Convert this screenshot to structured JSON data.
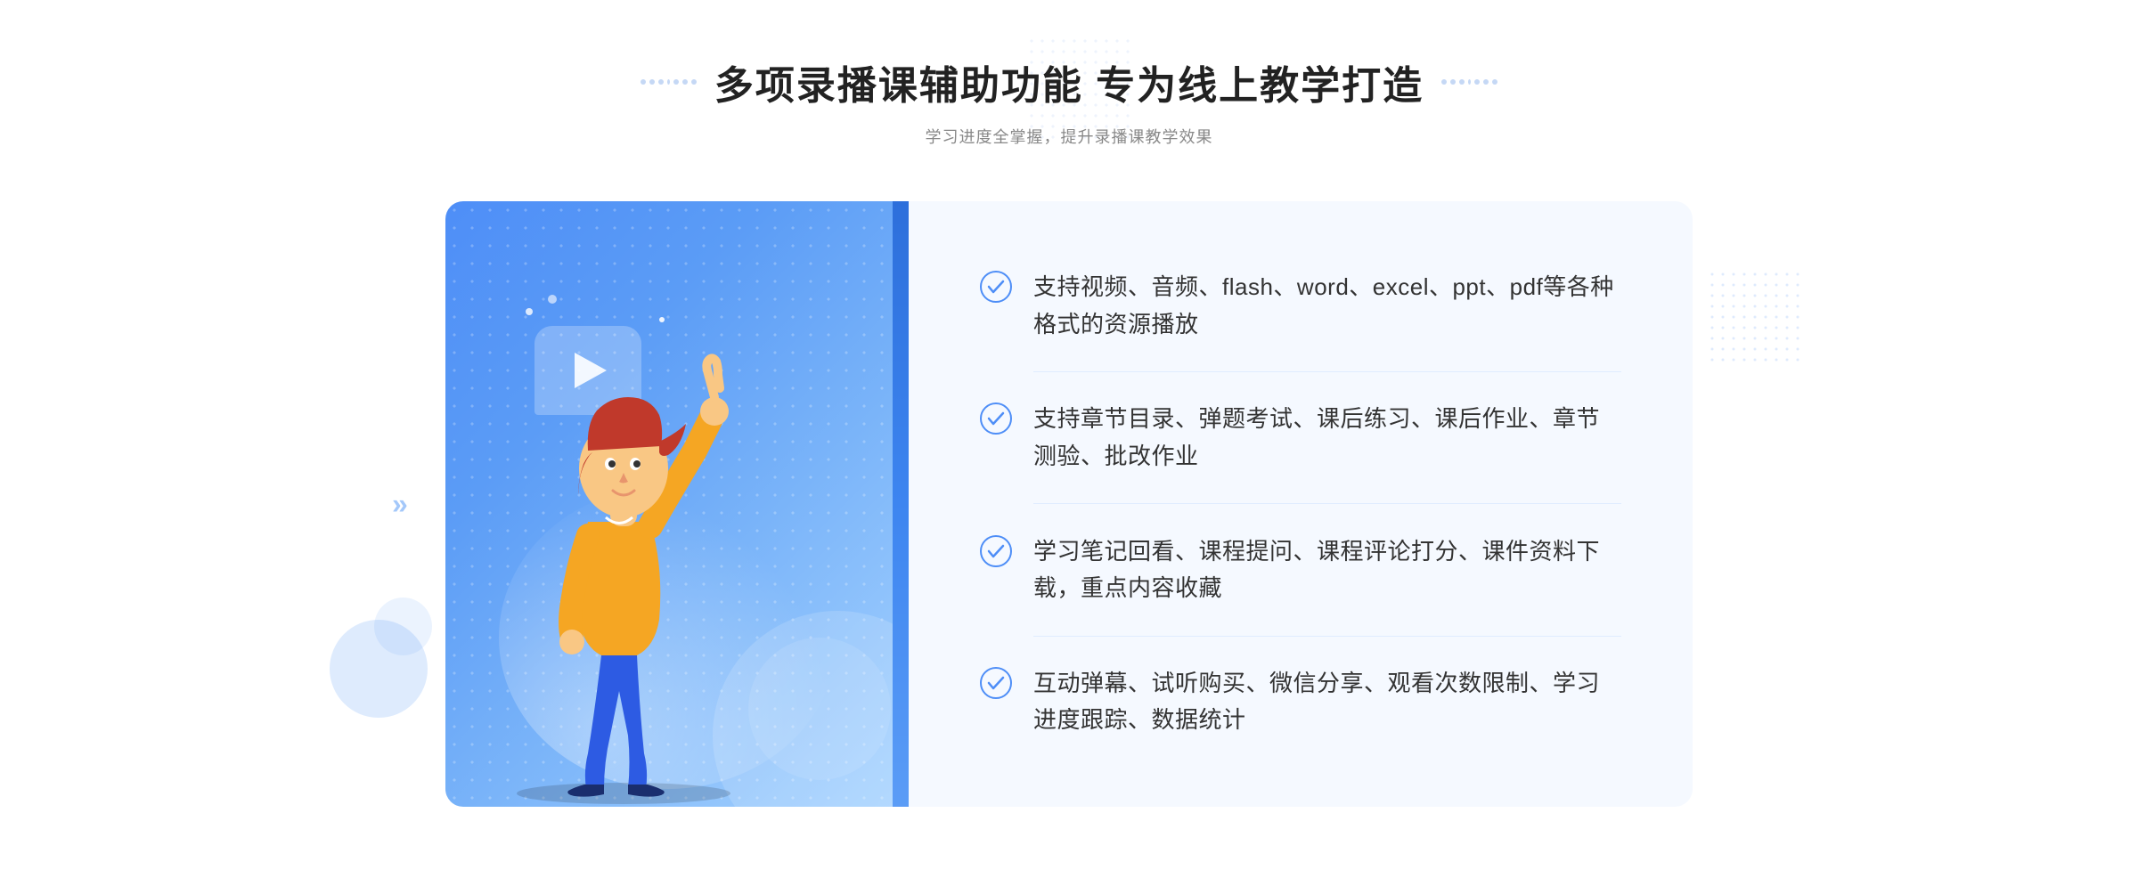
{
  "header": {
    "main_title": "多项录播课辅助功能 专为线上教学打造",
    "sub_title": "学习进度全掌握，提升录播课教学效果"
  },
  "features": [
    {
      "id": 1,
      "text": "支持视频、音频、flash、word、excel、ppt、pdf等各种格式的资源播放"
    },
    {
      "id": 2,
      "text": "支持章节目录、弹题考试、课后练习、课后作业、章节测验、批改作业"
    },
    {
      "id": 3,
      "text": "学习笔记回看、课程提问、课程评论打分、课件资料下载，重点内容收藏"
    },
    {
      "id": 4,
      "text": "互动弹幕、试听购买、微信分享、观看次数限制、学习进度跟踪、数据统计"
    }
  ],
  "decorations": {
    "dots_label": "::  ::",
    "left_arrows": "»"
  },
  "colors": {
    "primary_blue": "#4e8ef7",
    "light_blue": "#a8d4ff",
    "check_color": "#4e8ef7",
    "text_dark": "#333333",
    "text_light": "#888888"
  }
}
